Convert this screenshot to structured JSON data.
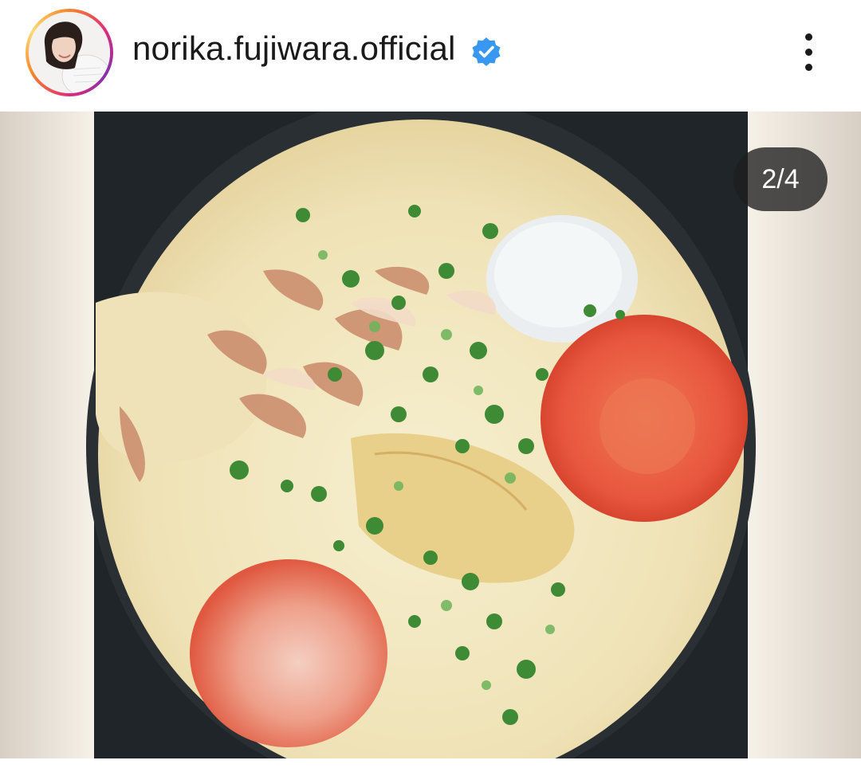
{
  "post_header": {
    "username": "norika.fujiwara.official",
    "verified": true,
    "avatar_icon": "profile-photo",
    "more_icon": "vertical-ellipsis-icon"
  },
  "carousel": {
    "counter": "2/4"
  },
  "photo": {
    "subject": "soup-bowl-photo"
  },
  "colors": {
    "verified_blue": "#3897f0",
    "story_ring": "#dd2a7b",
    "counter_bg": "#1e1e1e"
  }
}
